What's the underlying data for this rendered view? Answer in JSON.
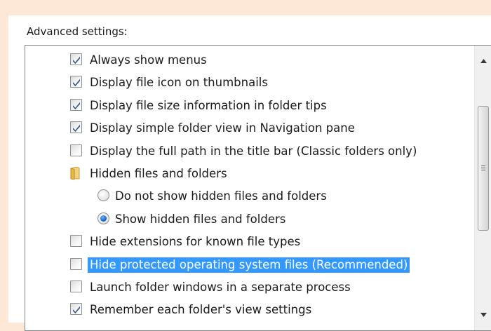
{
  "section": {
    "label": "Advanced settings:"
  },
  "items": [
    {
      "type": "checkbox",
      "checked": true,
      "label": "Always show menus"
    },
    {
      "type": "checkbox",
      "checked": true,
      "label": "Display file icon on thumbnails"
    },
    {
      "type": "checkbox",
      "checked": true,
      "label": "Display file size information in folder tips"
    },
    {
      "type": "checkbox",
      "checked": true,
      "label": "Display simple folder view in Navigation pane"
    },
    {
      "type": "checkbox",
      "checked": false,
      "label": "Display the full path in the title bar (Classic folders only)"
    },
    {
      "type": "folder",
      "icon": "folder-icon",
      "label": "Hidden files and folders"
    },
    {
      "type": "radio",
      "checked": false,
      "label": "Do not show hidden files and folders"
    },
    {
      "type": "radio",
      "checked": true,
      "label": "Show hidden files and folders"
    },
    {
      "type": "checkbox",
      "checked": false,
      "label": "Hide extensions for known file types"
    },
    {
      "type": "checkbox",
      "checked": false,
      "selected": true,
      "label": "Hide protected operating system files (Recommended)"
    },
    {
      "type": "checkbox",
      "checked": false,
      "label": "Launch folder windows in a separate process"
    },
    {
      "type": "checkbox",
      "checked": true,
      "label": "Remember each folder's view settings"
    }
  ],
  "colors": {
    "page_background": "#fde7d6",
    "selection": "#3399ff",
    "check_mark": "#2c4f87",
    "radio_dot": "#1c62c9",
    "folder": "#e8b84a"
  },
  "scrollbar": {
    "up_icon": "scroll-up-arrow-icon",
    "down_icon": "scroll-down-arrow-icon",
    "thumb_grip_icon": "grip-icon"
  }
}
